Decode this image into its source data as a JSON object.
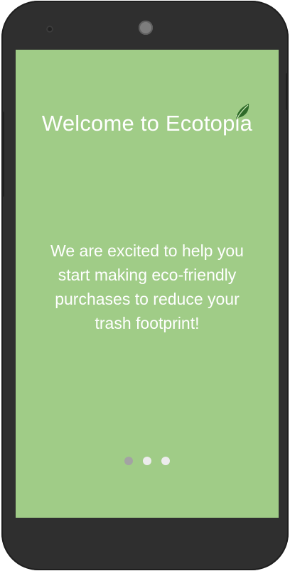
{
  "screen": {
    "title": "Welcome to Ecotopia",
    "message": "We are excited to help you start making eco-friendly purchases to reduce your trash footprint!",
    "background_color": "#a0cc87",
    "text_color": "#ffffff"
  },
  "pager": {
    "total": 3,
    "active_index": 0,
    "active_color": "#a3a3a3",
    "inactive_color": "#ececec"
  },
  "icons": {
    "logo_leaf": "leaf-icon"
  }
}
